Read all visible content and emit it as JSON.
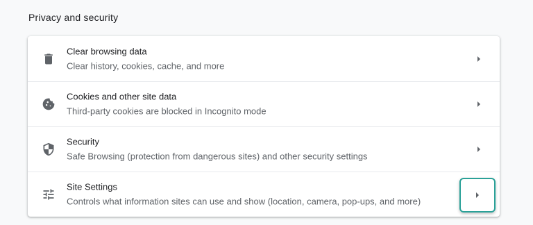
{
  "section": {
    "title": "Privacy and security"
  },
  "rows": [
    {
      "label": "Clear browsing data",
      "sublabel": "Clear history, cookies, cache, and more",
      "icon": "trash-icon"
    },
    {
      "label": "Cookies and other site data",
      "sublabel": "Third-party cookies are blocked in Incognito mode",
      "icon": "cookie-icon"
    },
    {
      "label": "Security",
      "sublabel": "Safe Browsing (protection from dangerous sites) and other security settings",
      "icon": "shield-icon"
    },
    {
      "label": "Site Settings",
      "sublabel": "Controls what information sites can use and show (location, camera, pop-ups, and more)",
      "icon": "tune-icon"
    }
  ],
  "colors": {
    "background": "#f8f9fa",
    "card": "#ffffff",
    "text_primary": "#202124",
    "text_secondary": "#5f6368",
    "highlight_border": "#2aa198"
  }
}
